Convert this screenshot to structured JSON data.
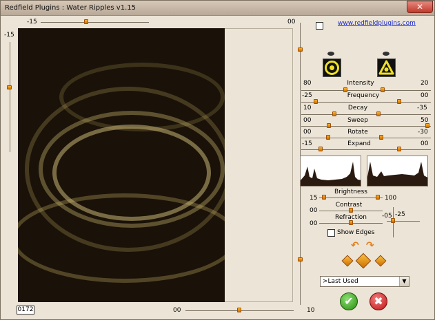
{
  "window": {
    "title": "Redfield Plugins : Water Ripples v1.15",
    "close_symbol": "✕"
  },
  "preview": {
    "top_slider_value": "-15",
    "top_right_value": "00",
    "left_slider_value": "-15",
    "bottom_slider_value": "00",
    "right_bottom_value": "10",
    "coord_readout": "0172"
  },
  "header": {
    "link": "www.redfieldplugins.com"
  },
  "sliders": [
    {
      "label": "Intensity",
      "left": "80",
      "right": "20"
    },
    {
      "label": "Frequency",
      "left": "-25",
      "right": "00"
    },
    {
      "label": "Decay",
      "left": "10",
      "right": "-35"
    },
    {
      "label": "Sweep",
      "left": "00",
      "right": "50"
    },
    {
      "label": "Rotate",
      "left": "00",
      "right": "-30"
    },
    {
      "label": "Expand",
      "left": "-15",
      "right": "00"
    }
  ],
  "lighting": {
    "brightness": {
      "label": "Brightness",
      "left": "15",
      "right": "100"
    },
    "contrast": {
      "label": "Contrast",
      "left": "00"
    },
    "refraction": {
      "label": "Refraction",
      "left": "00"
    },
    "side_left": "-05",
    "side_right": "-25"
  },
  "show_edges": {
    "label": "Show Edges"
  },
  "preset": {
    "selected": ">Last Used",
    "arrow": "▼"
  },
  "buttons": {
    "ok_symbol": "✔",
    "cancel_symbol": "✖"
  },
  "colors": {
    "thumb": "#f0a020",
    "accent_link": "#1a2ad0",
    "ok": "#2a8a10",
    "cancel": "#c01010"
  }
}
